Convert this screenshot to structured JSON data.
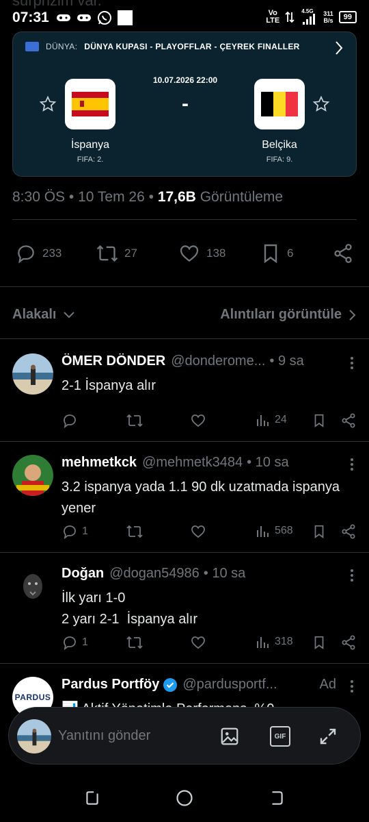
{
  "status_bar": {
    "ghost_text": "surprizim var.",
    "time": "07:31",
    "network": "Vo LTE",
    "net_type": "4.5G",
    "speed_value": "311",
    "speed_unit": "B/s",
    "battery": "99"
  },
  "match_card": {
    "label": "DÜNYA:",
    "competition": "DÜNYA KUPASI - PLAYOFFLAR - ÇEYREK FINALLER",
    "date": "10.07.2026 22:00",
    "score": "-",
    "home": {
      "name": "İspanya",
      "rank": "FIFA: 2."
    },
    "away": {
      "name": "Belçika",
      "rank": "FIFA: 9."
    }
  },
  "post_meta": {
    "time": "8:30 ÖS",
    "date": "10 Tem 26",
    "views": "17,6B",
    "views_label": "Görüntüleme"
  },
  "post_actions": {
    "replies": "233",
    "reposts": "27",
    "likes": "138",
    "bookmarks": "6"
  },
  "filter": {
    "sort_label": "Alakalı",
    "quotes_label": "Alıntıları görüntüle"
  },
  "replies": [
    {
      "name": "ÖMER DÖNDER",
      "handle": "@donderome...",
      "time": "• 9 sa",
      "text": "2-1 İspanya alır",
      "replies": "",
      "views": "24"
    },
    {
      "name": "mehmetkck",
      "handle": "@mehmetk3484",
      "time": "• 10 sa",
      "text": "3.2 ispanya yada 1.1 90 dk uzatmada ispanya yener",
      "replies": "1",
      "views": "568"
    },
    {
      "name": "Doğan",
      "handle": "@dogan54986",
      "time": "• 10 sa",
      "text_line1": "İlk yarı 1-0",
      "text_line2": "2 yarı 2-1  İspanya alır",
      "replies": "1",
      "views": "318"
    }
  ],
  "ad": {
    "name": "Pardus Portföy",
    "handle": "@pardusportf...",
    "tag": "Ad",
    "logo_text": "PARDUS",
    "text": "📊 Aktif Yönetimle Performans, %0"
  },
  "composer": {
    "placeholder": "Yanıtını gönder",
    "gif_label": "GIF"
  },
  "colors": {
    "background": "#000000",
    "card_bg": "#0b232e",
    "muted": "#71767b",
    "verified": "#1d9bf0"
  }
}
